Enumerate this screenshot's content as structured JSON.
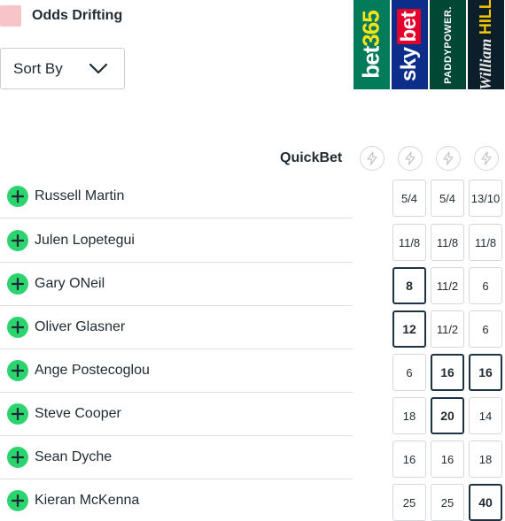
{
  "legend": {
    "label": "Odds Drifting",
    "color": "#f7c4c9"
  },
  "sort": {
    "label": "Sort By",
    "icon": "chevron-down-icon"
  },
  "bookmakers": [
    {
      "name": "bet365",
      "logo_main": "bet",
      "logo_accent": "365",
      "color": "#027b5b"
    },
    {
      "name": "sky bet",
      "logo_main": "sky",
      "logo_accent": "bet",
      "color": "#0d2d8a"
    },
    {
      "name": "Paddy Power",
      "logo_main": "PADDYPOWER.",
      "logo_accent": "",
      "color": "#004833"
    },
    {
      "name": "William Hill",
      "logo_main": "William",
      "logo_accent": "HILL",
      "color": "#0b1e2a"
    }
  ],
  "quickbet": {
    "label": "QuickBet",
    "icon": "lightning-icon"
  },
  "runners": [
    {
      "name": "Russell Martin",
      "odds": [
        {
          "v": "5/4",
          "hl": false
        },
        {
          "v": "5/4",
          "hl": false
        },
        {
          "v": "13/10",
          "hl": false
        }
      ]
    },
    {
      "name": "Julen Lopetegui",
      "odds": [
        {
          "v": "11/8",
          "hl": false
        },
        {
          "v": "11/8",
          "hl": false
        },
        {
          "v": "11/8",
          "hl": false
        }
      ]
    },
    {
      "name": "Gary ONeil",
      "odds": [
        {
          "v": "8",
          "hl": true
        },
        {
          "v": "11/2",
          "hl": false
        },
        {
          "v": "6",
          "hl": false
        }
      ]
    },
    {
      "name": "Oliver Glasner",
      "odds": [
        {
          "v": "12",
          "hl": true
        },
        {
          "v": "11/2",
          "hl": false
        },
        {
          "v": "6",
          "hl": false
        }
      ]
    },
    {
      "name": "Ange Postecoglou",
      "odds": [
        {
          "v": "6",
          "hl": false
        },
        {
          "v": "16",
          "hl": true
        },
        {
          "v": "16",
          "hl": true
        }
      ]
    },
    {
      "name": "Steve Cooper",
      "odds": [
        {
          "v": "18",
          "hl": false
        },
        {
          "v": "20",
          "hl": true
        },
        {
          "v": "14",
          "hl": false
        }
      ]
    },
    {
      "name": "Sean Dyche",
      "odds": [
        {
          "v": "16",
          "hl": false
        },
        {
          "v": "16",
          "hl": false
        },
        {
          "v": "18",
          "hl": false
        }
      ]
    },
    {
      "name": "Kieran McKenna",
      "odds": [
        {
          "v": "25",
          "hl": false
        },
        {
          "v": "25",
          "hl": false
        },
        {
          "v": "40",
          "hl": true
        }
      ]
    }
  ]
}
